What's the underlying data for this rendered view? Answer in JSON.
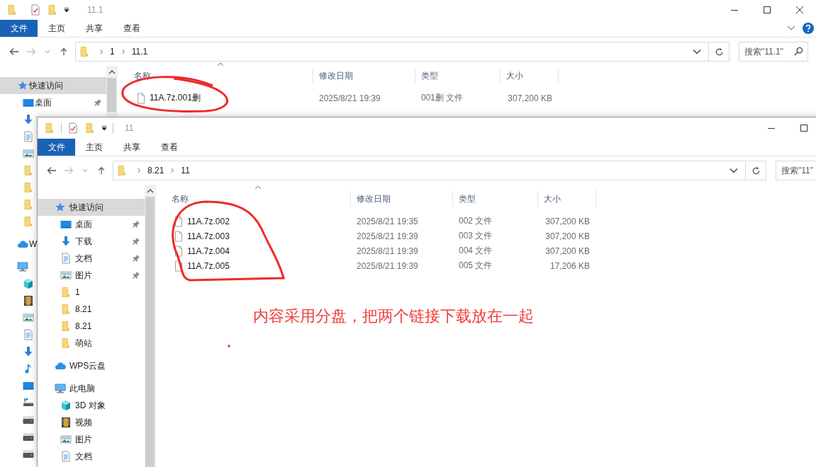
{
  "windows": [
    {
      "title": "11.1",
      "ribbon_tabs": [
        {
          "label": "文件",
          "kind": "file"
        },
        {
          "label": "主页",
          "kind": "tab"
        },
        {
          "label": "共享",
          "kind": "tab"
        },
        {
          "label": "查看",
          "kind": "tab"
        }
      ],
      "help_button": true,
      "window_buttons": [
        {
          "kind": "minimize"
        },
        {
          "kind": "maximize"
        },
        {
          "kind": "close"
        }
      ],
      "forward_enabled": false,
      "path": [
        "1",
        "11.1"
      ],
      "search": {
        "placeholder": "搜索\"11.1\"",
        "icon": true
      },
      "sidebar": [
        {
          "label": "快速访问",
          "kind": "star",
          "selected": true,
          "children": [
            {
              "label": "桌面",
              "kind": "desktop",
              "selected": false,
              "pinned": true
            },
            {
              "kind": "download",
              "selected": false
            },
            {
              "kind": "document",
              "selected": false
            },
            {
              "kind": "pictures",
              "selected": false
            },
            {
              "kind": "folder",
              "selected": false
            },
            {
              "kind": "folder",
              "selected": false
            },
            {
              "kind": "folder",
              "selected": false
            },
            {
              "kind": "folder",
              "selected": false
            }
          ]
        },
        {
          "label": "W",
          "kind": "cloud",
          "selected": false
        },
        {
          "kind": "pc",
          "selected": false,
          "children": [
            {
              "kind": "cube",
              "selected": false
            },
            {
              "kind": "video",
              "selected": false
            },
            {
              "kind": "pictures",
              "selected": false
            },
            {
              "kind": "document",
              "selected": false
            },
            {
              "kind": "download",
              "selected": false
            },
            {
              "kind": "music",
              "selected": false
            },
            {
              "kind": "desktop",
              "selected": false
            },
            {
              "kind": "windows_drive",
              "selected": false
            },
            {
              "kind": "drive",
              "selected": false
            },
            {
              "kind": "drive",
              "selected": false
            },
            {
              "kind": "drive",
              "selected": false
            }
          ]
        }
      ],
      "columns": [
        "名称",
        "修改日期",
        "类型",
        "大小"
      ],
      "files": [
        {
          "name": "11A.7z.001删",
          "modified": "2025/8/21 19:39",
          "type": "001删 文件",
          "size": "307,200 KB"
        }
      ]
    },
    {
      "title": "11",
      "ribbon_tabs": [
        {
          "label": "文件",
          "kind": "file"
        },
        {
          "label": "主页",
          "kind": "tab"
        },
        {
          "label": "共享",
          "kind": "tab"
        },
        {
          "label": "查看",
          "kind": "tab"
        }
      ],
      "window_buttons": [
        {
          "kind": "minimize"
        },
        {
          "kind": "maximize"
        }
      ],
      "forward_enabled": false,
      "path": [
        "8.21",
        "11"
      ],
      "search": {
        "placeholder": "搜索\"11\""
      },
      "sidebar": [
        {
          "label": "快速访问",
          "kind": "star",
          "selected": true,
          "children": [
            {
              "label": "桌面",
              "kind": "desktop",
              "selected": false,
              "pinned": true
            },
            {
              "label": "下载",
              "kind": "download",
              "selected": false,
              "pinned": true
            },
            {
              "label": "文档",
              "kind": "document",
              "selected": false,
              "pinned": true
            },
            {
              "label": "图片",
              "kind": "pictures",
              "selected": false,
              "pinned": true
            },
            {
              "label": "1",
              "kind": "folder",
              "selected": false,
              "pinned": false
            },
            {
              "label": "8.21",
              "kind": "folder",
              "selected": false,
              "pinned": false
            },
            {
              "label": "8.21",
              "kind": "folder",
              "selected": false,
              "pinned": false
            },
            {
              "label": "萌站",
              "kind": "folder",
              "selected": false,
              "pinned": false
            }
          ]
        },
        {
          "label": "WPS云盘",
          "kind": "cloud",
          "selected": false
        },
        {
          "label": "此电脑",
          "kind": "pc",
          "selected": false,
          "children": [
            {
              "label": "3D 对象",
              "kind": "cube",
              "selected": false
            },
            {
              "label": "视频",
              "kind": "video",
              "selected": false
            },
            {
              "label": "图片",
              "kind": "pictures",
              "selected": false
            },
            {
              "label": "文档",
              "kind": "document",
              "selected": false
            }
          ]
        }
      ],
      "columns": [
        "名称",
        "修改日期",
        "类型",
        "大小"
      ],
      "files": [
        {
          "name": "11A.7z.002",
          "modified": "2025/8/21 19:35",
          "type": "002 文件",
          "size": "307,200 KB"
        },
        {
          "name": "11A.7z.003",
          "modified": "2025/8/21 19:39",
          "type": "003 文件",
          "size": "307,200 KB"
        },
        {
          "name": "11A.7z.004",
          "modified": "2025/8/21 19:39",
          "type": "004 文件",
          "size": "307,200 KB"
        },
        {
          "name": "11A.7z.005",
          "modified": "2025/8/21 19:39",
          "type": "005 文件",
          "size": "17,206 KB"
        }
      ]
    }
  ],
  "annotation_text": "内容采用分盘，把两个链接下载放在一起"
}
